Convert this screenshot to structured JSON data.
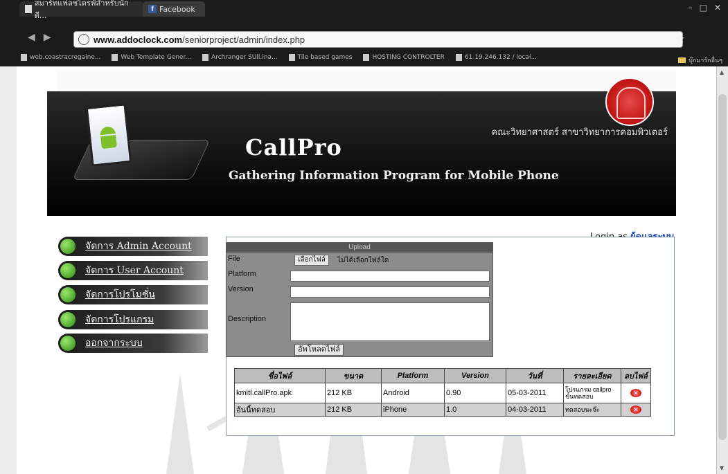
{
  "browser": {
    "tabs": [
      {
        "label": "สมาร์ทแฟลชไดรฟ์สำหรับนักดี..."
      },
      {
        "label": "Facebook"
      }
    ],
    "address": {
      "host": "www.addoclock.com",
      "path": "/seniorproject/admin/index.php"
    },
    "bookmarks": [
      {
        "label": "web.coastracregaine..."
      },
      {
        "label": "Web Template Gener..."
      },
      {
        "label": "Archranger SUll.ina..."
      },
      {
        "label": "Tile based games"
      },
      {
        "label": "HOSTING CONTROLTER"
      },
      {
        "label": "61.19.246.132 / local..."
      }
    ],
    "other_bookmarks": "บุ๊กมาร์กอื่นๆ"
  },
  "header": {
    "faculty": "คณะวิทยาศาสตร์ สาขาวิทยาการคอมพิวเตอร์",
    "title": "CallPro",
    "subtitle": "Gathering Information Program for Mobile Phone"
  },
  "menu": [
    {
      "label": "จัดการ Admin Account"
    },
    {
      "label": "จัดการ User Account"
    },
    {
      "label": "จัดการโปรโมชั่น"
    },
    {
      "label": "จัดการโปรแกรม"
    },
    {
      "label": "ออกจากระบบ"
    }
  ],
  "login": {
    "prefix": "Login as",
    "user": "ผู้ดูแลระบบ"
  },
  "upload": {
    "title": "Upload",
    "file_label": "File",
    "file_button": "เลือกไฟล์",
    "file_note": "ไม่ได้เลือกไฟล์ใด",
    "platform_label": "Platform",
    "version_label": "Version",
    "description_label": "Description",
    "submit_label": "อัพโหลดไฟล์"
  },
  "table": {
    "headers": [
      "ชื่อไฟล์",
      "ขนาด",
      "Platform",
      "Version",
      "วันที่",
      "รายละเอียด",
      "ลบไฟล์"
    ],
    "rows": [
      {
        "name": "kmitl.callPro.apk",
        "size": "212 KB",
        "platform": "Android",
        "version": "0.90",
        "date": "05-03-2011",
        "detail": "โปรแกรม callpro ขั้นทดสอบ"
      },
      {
        "name": "อันนี้ทดสอบ",
        "size": "212 KB",
        "platform": "iPhone",
        "version": "1.0",
        "date": "04-03-2011",
        "detail": "ทดสอบนะจ๊ะ"
      }
    ]
  }
}
